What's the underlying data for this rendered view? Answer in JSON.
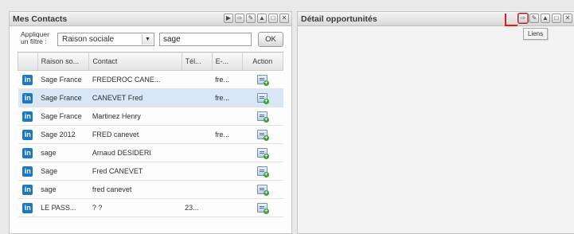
{
  "contacts_panel": {
    "title": "Mes Contacts",
    "filter": {
      "label": "Appliquer un filtre :",
      "field_selected": "Raison sociale",
      "search_value": "sage",
      "ok_label": "OK"
    },
    "columns": [
      "Raison so...",
      "Contact",
      "Tél...",
      "E-...",
      "Action"
    ],
    "rows": [
      {
        "raison": "Sage France",
        "contact": "FREDEROC CANE...",
        "tel": "",
        "email": "fre..."
      },
      {
        "raison": "Sage France",
        "contact": "CANEVET Fred",
        "tel": "",
        "email": "fre..."
      },
      {
        "raison": "Sage France",
        "contact": "Martinez Henry",
        "tel": "",
        "email": ""
      },
      {
        "raison": "Sage 2012",
        "contact": "FRED canevet",
        "tel": "",
        "email": "fre..."
      },
      {
        "raison": "sage",
        "contact": "Arnaud DESIDERI",
        "tel": "",
        "email": ""
      },
      {
        "raison": "Sage",
        "contact": "Fred CANEVET",
        "tel": "",
        "email": ""
      },
      {
        "raison": "sage",
        "contact": "fred canevet",
        "tel": "",
        "email": ""
      },
      {
        "raison": "LE PASS...",
        "contact": "? ?",
        "tel": "23...",
        "email": ""
      }
    ],
    "selected_row": 1,
    "row_icon": "linkedin-icon",
    "action_icon": "add-contact-card-icon"
  },
  "opportunity_panel": {
    "title": "Détail opportunités",
    "tooltip": "Liens"
  },
  "colors": {
    "selected_row": "#d9e6f5",
    "linkedin": "#1b78c4",
    "highlight_red": "#e01a1a"
  }
}
